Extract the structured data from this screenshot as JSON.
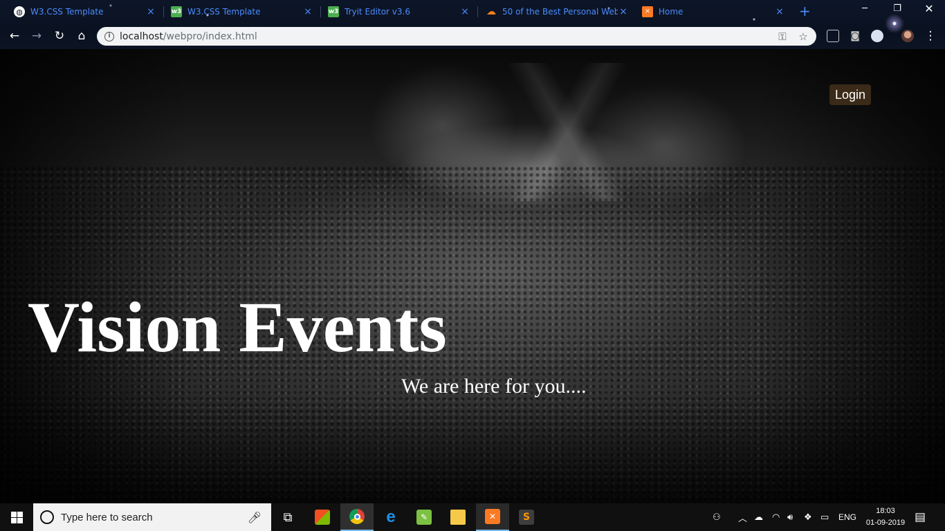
{
  "browser": {
    "tabs": [
      {
        "title": "W3.CSS Template",
        "favicon": "globe-icon"
      },
      {
        "title": "W3.CSS Template",
        "favicon": "w3-icon"
      },
      {
        "title": "Tryit Editor v3.6",
        "favicon": "w3-icon"
      },
      {
        "title": "50 of the Best Personal Websit",
        "favicon": "cloud-icon"
      },
      {
        "title": "Home",
        "favicon": "xampp-icon"
      }
    ],
    "close_glyph": "×",
    "new_tab_glyph": "+",
    "url_host": "localhost",
    "url_path": "/webpro/index.html",
    "accent_color": "#4a8cff"
  },
  "page": {
    "login_label": "Login",
    "hero_title": "Vision Events",
    "hero_subtitle": "We are here for you....",
    "login_bg_color": "#3b2a18"
  },
  "taskbar": {
    "search_placeholder": "Type here to search",
    "language": "ENG",
    "time": "18:03",
    "date": "01-09-2019"
  }
}
